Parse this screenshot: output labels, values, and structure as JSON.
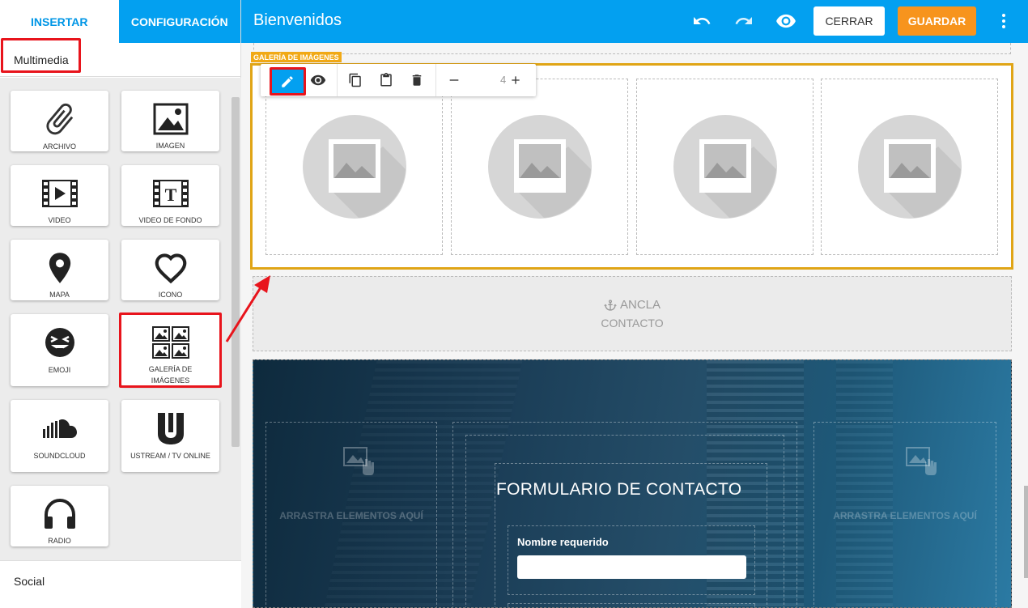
{
  "sidebar": {
    "tabs": [
      {
        "label": "INSERTAR"
      },
      {
        "label": "CONFIGURACIÓN"
      }
    ],
    "section_title": "Multimedia",
    "items": [
      {
        "label": "ARCHIVO",
        "icon": "paperclip-icon"
      },
      {
        "label": "IMAGEN",
        "icon": "image-icon"
      },
      {
        "label": "VIDEO",
        "icon": "film-play-icon"
      },
      {
        "label": "VIDEO DE FONDO",
        "icon": "film-text-icon"
      },
      {
        "label": "MAPA",
        "icon": "map-pin-icon"
      },
      {
        "label": "ICONO",
        "icon": "heart-icon"
      },
      {
        "label": "EMOJI",
        "icon": "emoji-icon"
      },
      {
        "label": "GALERÍA DE IMÁGENES",
        "icon": "gallery-icon"
      },
      {
        "label": "SOUNDCLOUD",
        "icon": "soundcloud-icon"
      },
      {
        "label": "USTREAM / TV ONLINE",
        "icon": "ustream-icon"
      },
      {
        "label": "RADIO",
        "icon": "headphones-icon"
      }
    ],
    "next_section": "Social"
  },
  "topbar": {
    "title": "Bienvenidos",
    "close_label": "CERRAR",
    "save_label": "GUARDAR"
  },
  "canvas": {
    "gallery_tag": "GALERÍA DE IMÁGENES",
    "gallery_columns": "4",
    "anchor_label": "ANCLA",
    "anchor_name": "CONTACTO",
    "dropzone_text": "ARRASTRA ELEMENTOS AQUÍ",
    "form_title": "FORMULARIO DE CONTACTO",
    "field_label": "Nombre",
    "field_required": "requerido"
  },
  "colors": {
    "primary": "#03a0f0",
    "save": "#f7941d",
    "gallery_border": "#e0a516",
    "highlight": "#e8141c"
  }
}
